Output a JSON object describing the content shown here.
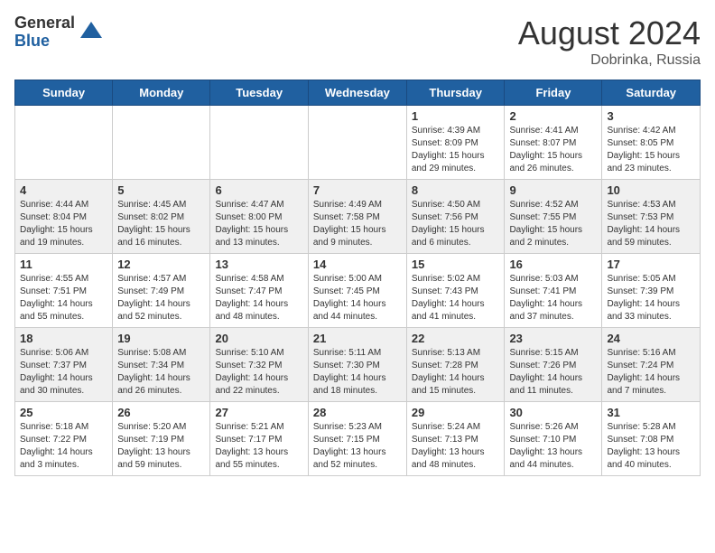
{
  "header": {
    "logo_general": "General",
    "logo_blue": "Blue",
    "month_year": "August 2024",
    "location": "Dobrinka, Russia"
  },
  "days_of_week": [
    "Sunday",
    "Monday",
    "Tuesday",
    "Wednesday",
    "Thursday",
    "Friday",
    "Saturday"
  ],
  "weeks": [
    [
      {
        "num": "",
        "info": ""
      },
      {
        "num": "",
        "info": ""
      },
      {
        "num": "",
        "info": ""
      },
      {
        "num": "",
        "info": ""
      },
      {
        "num": "1",
        "info": "Sunrise: 4:39 AM\nSunset: 8:09 PM\nDaylight: 15 hours and 29 minutes."
      },
      {
        "num": "2",
        "info": "Sunrise: 4:41 AM\nSunset: 8:07 PM\nDaylight: 15 hours and 26 minutes."
      },
      {
        "num": "3",
        "info": "Sunrise: 4:42 AM\nSunset: 8:05 PM\nDaylight: 15 hours and 23 minutes."
      }
    ],
    [
      {
        "num": "4",
        "info": "Sunrise: 4:44 AM\nSunset: 8:04 PM\nDaylight: 15 hours and 19 minutes."
      },
      {
        "num": "5",
        "info": "Sunrise: 4:45 AM\nSunset: 8:02 PM\nDaylight: 15 hours and 16 minutes."
      },
      {
        "num": "6",
        "info": "Sunrise: 4:47 AM\nSunset: 8:00 PM\nDaylight: 15 hours and 13 minutes."
      },
      {
        "num": "7",
        "info": "Sunrise: 4:49 AM\nSunset: 7:58 PM\nDaylight: 15 hours and 9 minutes."
      },
      {
        "num": "8",
        "info": "Sunrise: 4:50 AM\nSunset: 7:56 PM\nDaylight: 15 hours and 6 minutes."
      },
      {
        "num": "9",
        "info": "Sunrise: 4:52 AM\nSunset: 7:55 PM\nDaylight: 15 hours and 2 minutes."
      },
      {
        "num": "10",
        "info": "Sunrise: 4:53 AM\nSunset: 7:53 PM\nDaylight: 14 hours and 59 minutes."
      }
    ],
    [
      {
        "num": "11",
        "info": "Sunrise: 4:55 AM\nSunset: 7:51 PM\nDaylight: 14 hours and 55 minutes."
      },
      {
        "num": "12",
        "info": "Sunrise: 4:57 AM\nSunset: 7:49 PM\nDaylight: 14 hours and 52 minutes."
      },
      {
        "num": "13",
        "info": "Sunrise: 4:58 AM\nSunset: 7:47 PM\nDaylight: 14 hours and 48 minutes."
      },
      {
        "num": "14",
        "info": "Sunrise: 5:00 AM\nSunset: 7:45 PM\nDaylight: 14 hours and 44 minutes."
      },
      {
        "num": "15",
        "info": "Sunrise: 5:02 AM\nSunset: 7:43 PM\nDaylight: 14 hours and 41 minutes."
      },
      {
        "num": "16",
        "info": "Sunrise: 5:03 AM\nSunset: 7:41 PM\nDaylight: 14 hours and 37 minutes."
      },
      {
        "num": "17",
        "info": "Sunrise: 5:05 AM\nSunset: 7:39 PM\nDaylight: 14 hours and 33 minutes."
      }
    ],
    [
      {
        "num": "18",
        "info": "Sunrise: 5:06 AM\nSunset: 7:37 PM\nDaylight: 14 hours and 30 minutes."
      },
      {
        "num": "19",
        "info": "Sunrise: 5:08 AM\nSunset: 7:34 PM\nDaylight: 14 hours and 26 minutes."
      },
      {
        "num": "20",
        "info": "Sunrise: 5:10 AM\nSunset: 7:32 PM\nDaylight: 14 hours and 22 minutes."
      },
      {
        "num": "21",
        "info": "Sunrise: 5:11 AM\nSunset: 7:30 PM\nDaylight: 14 hours and 18 minutes."
      },
      {
        "num": "22",
        "info": "Sunrise: 5:13 AM\nSunset: 7:28 PM\nDaylight: 14 hours and 15 minutes."
      },
      {
        "num": "23",
        "info": "Sunrise: 5:15 AM\nSunset: 7:26 PM\nDaylight: 14 hours and 11 minutes."
      },
      {
        "num": "24",
        "info": "Sunrise: 5:16 AM\nSunset: 7:24 PM\nDaylight: 14 hours and 7 minutes."
      }
    ],
    [
      {
        "num": "25",
        "info": "Sunrise: 5:18 AM\nSunset: 7:22 PM\nDaylight: 14 hours and 3 minutes."
      },
      {
        "num": "26",
        "info": "Sunrise: 5:20 AM\nSunset: 7:19 PM\nDaylight: 13 hours and 59 minutes."
      },
      {
        "num": "27",
        "info": "Sunrise: 5:21 AM\nSunset: 7:17 PM\nDaylight: 13 hours and 55 minutes."
      },
      {
        "num": "28",
        "info": "Sunrise: 5:23 AM\nSunset: 7:15 PM\nDaylight: 13 hours and 52 minutes."
      },
      {
        "num": "29",
        "info": "Sunrise: 5:24 AM\nSunset: 7:13 PM\nDaylight: 13 hours and 48 minutes."
      },
      {
        "num": "30",
        "info": "Sunrise: 5:26 AM\nSunset: 7:10 PM\nDaylight: 13 hours and 44 minutes."
      },
      {
        "num": "31",
        "info": "Sunrise: 5:28 AM\nSunset: 7:08 PM\nDaylight: 13 hours and 40 minutes."
      }
    ]
  ]
}
